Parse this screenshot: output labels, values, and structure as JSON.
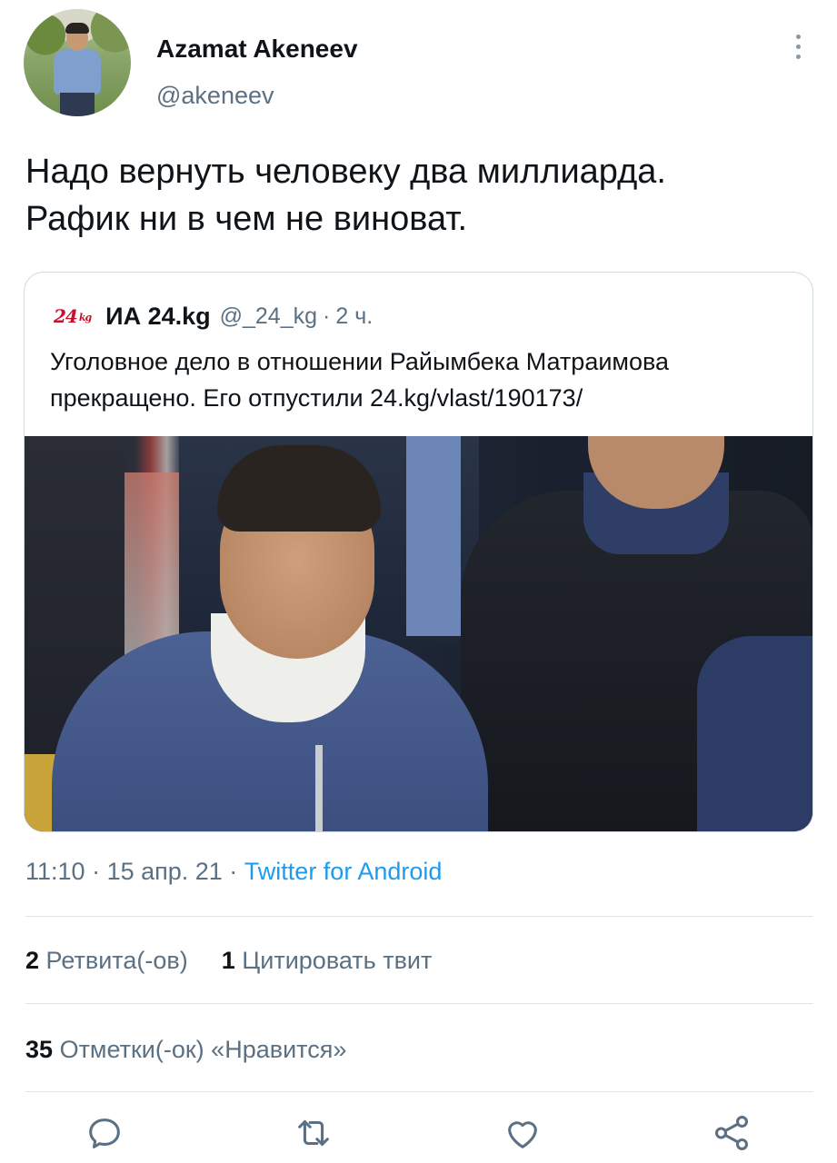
{
  "author": {
    "display_name": "Azamat Akeneev",
    "handle": "@akeneev"
  },
  "tweet": {
    "text_lines": [
      "Надо вернуть человеку два миллиарда.",
      "Рафик ни в чем не виноват."
    ]
  },
  "quoted_tweet": {
    "logo_text": "24.kg",
    "name": "ИА 24.kg",
    "handle": "@_24_kg",
    "separator": "·",
    "time": "2 ч.",
    "text_lines": [
      "Уголовное дело в отношении Райымбека Матраимова",
      "прекращено. Его отпустили 24.kg/vlast/190173/"
    ]
  },
  "meta": {
    "time": "11:10",
    "separator": " · ",
    "date": "15 апр. 21",
    "source": "Twitter for Android"
  },
  "stats": {
    "retweets_count": "2",
    "retweets_label": "Ретвита(-ов)",
    "quotes_count": "1",
    "quotes_label": "Цитировать твит",
    "likes_count": "35",
    "likes_label": "Отметки(-ок) «Нравится»"
  },
  "actions": [
    {
      "icon": "reply-icon"
    },
    {
      "icon": "retweet-icon"
    },
    {
      "icon": "like-icon"
    },
    {
      "icon": "share-icon"
    }
  ],
  "colors": {
    "text": "#0f1419",
    "secondary": "#5b7083",
    "link": "#1d9bf0",
    "border": "#cfd9de",
    "logo_red": "#c8102e"
  }
}
